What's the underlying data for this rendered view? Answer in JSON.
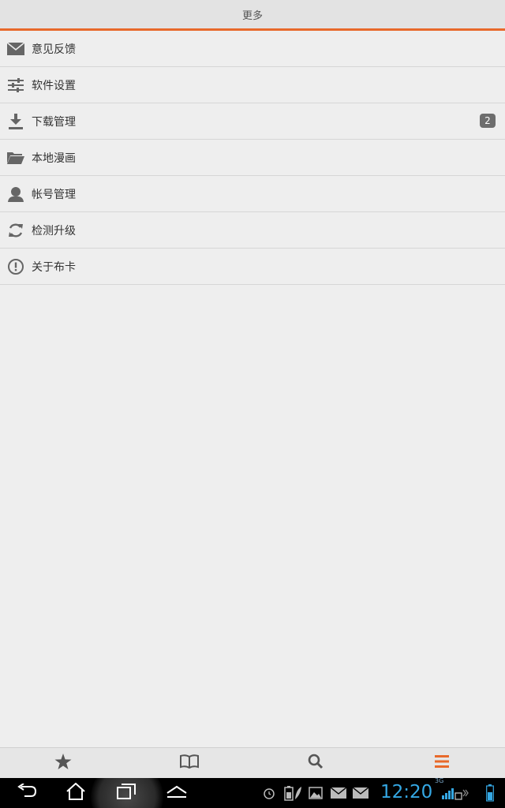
{
  "header": {
    "title": "更多"
  },
  "menu": {
    "items": [
      {
        "label": "意见反馈",
        "icon": "mail-icon"
      },
      {
        "label": "软件设置",
        "icon": "sliders-icon"
      },
      {
        "label": "下载管理",
        "icon": "download-icon",
        "badge": "2"
      },
      {
        "label": "本地漫画",
        "icon": "folder-icon"
      },
      {
        "label": "帐号管理",
        "icon": "user-icon"
      },
      {
        "label": "检测升级",
        "icon": "refresh-icon"
      },
      {
        "label": "关于布卡",
        "icon": "info-icon"
      }
    ]
  },
  "tabbar": {
    "tabs": [
      {
        "icon": "star-icon"
      },
      {
        "icon": "book-icon"
      },
      {
        "icon": "search-icon"
      },
      {
        "icon": "menu-icon",
        "active": true
      }
    ],
    "active_color": "#e8692b"
  },
  "statusbar": {
    "time": "12:20",
    "network": "3G",
    "icons": [
      "alarm-icon",
      "battery-saver-icon",
      "image-icon",
      "mail-icon",
      "mail-icon",
      "signal-icon",
      "battery-icon"
    ]
  },
  "colors": {
    "accent": "#e8692b",
    "clock": "#35a8e4"
  }
}
